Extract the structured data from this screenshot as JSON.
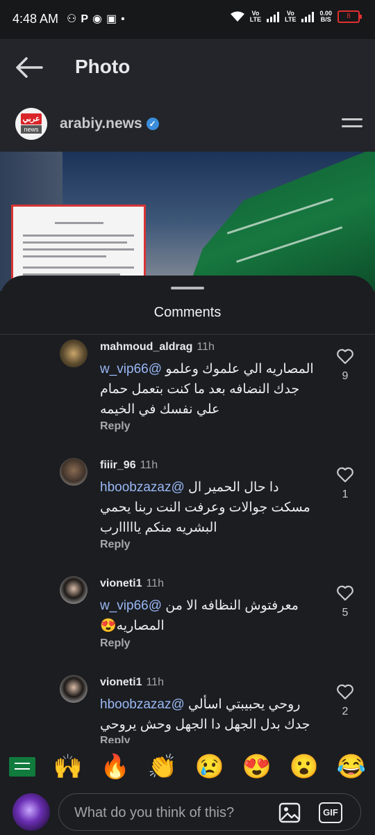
{
  "status_bar": {
    "time": "4:48 AM",
    "left_icons": [
      "gamepad-icon",
      "p-icon",
      "hotspot-icon",
      "cast-icon",
      "dot"
    ],
    "volte_label": "Vo\nLTE",
    "speed_label": "0.00\nB/S",
    "battery_level": "8"
  },
  "topbar": {
    "title": "Photo"
  },
  "post": {
    "account_handle": "arabiy.news",
    "logo_top_text": "عربي",
    "logo_bottom_text": "news"
  },
  "sheet": {
    "title": "Comments"
  },
  "comments": [
    {
      "username": "mahmoud_aldrag",
      "time": "11h",
      "text_before_mention": "المصاريه الي علموك وعلمو ",
      "mention": "@w_vip66",
      "text_after_mention": " جدك النضافه بعد ما كنت بتعمل حمام علي نفسك في الخيمه",
      "reply_label": "Reply",
      "likes": "9"
    },
    {
      "username": "fiiir_96",
      "time": "11h",
      "text_before_mention": "دا حال الحمير ال ",
      "mention": "@hboobzazaz",
      "text_after_mention": " مسكت جوالات وعرفت النت ربنا يحمي البشريه منكم يااااارب",
      "reply_label": "Reply",
      "likes": "1"
    },
    {
      "username": "vioneti1",
      "time": "11h",
      "text_before_mention": "معرفتوش النظافه الا من ",
      "mention": "@w_vip66",
      "text_after_mention": " المصاريه😍",
      "reply_label": "Reply",
      "likes": "5"
    },
    {
      "username": "vioneti1",
      "time": "11h",
      "text_before_mention": "روحي يحبيبتي اسألي ",
      "mention": "@hboobzazaz",
      "text_after_mention": " جدك بدل الجهل دا الجهل وحش يروحي",
      "reply_label": "Reply",
      "likes": "2"
    }
  ],
  "emoji_bar": [
    "🇸🇦",
    "🙌",
    "🔥",
    "👏",
    "😢",
    "😍",
    "😮",
    "😂"
  ],
  "composer": {
    "placeholder": "What do you think of this?",
    "gif_label": "GIF"
  },
  "colors": {
    "background": "#1b1d21",
    "mention": "#9ab8f5",
    "verified": "#3c8ddc",
    "battery_low": "#e03030"
  }
}
